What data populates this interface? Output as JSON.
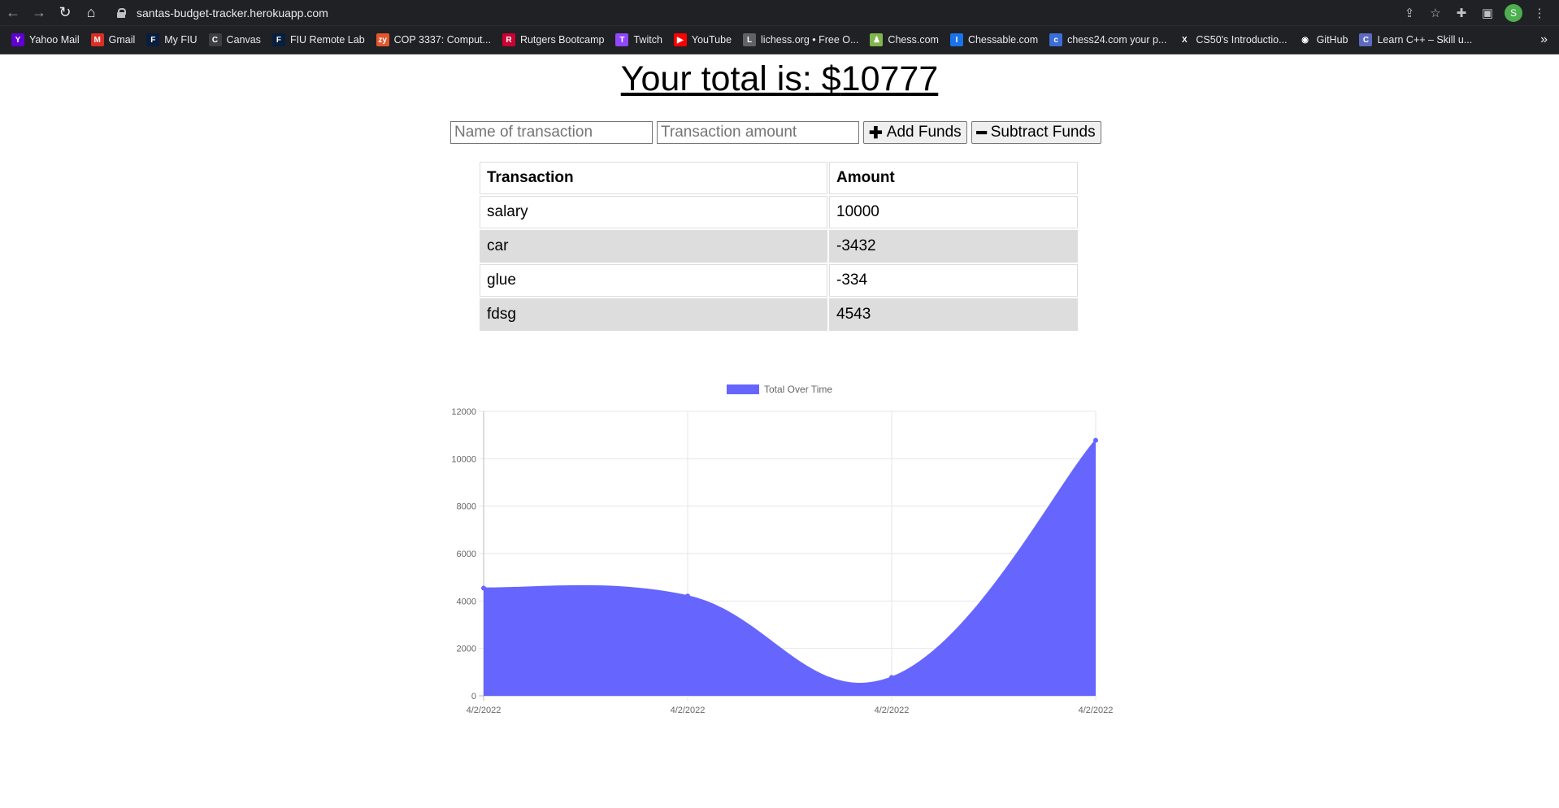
{
  "browser": {
    "url": "santas-budget-tracker.herokuapp.com",
    "avatar_letter": "S",
    "bookmarks": [
      {
        "label": "Yahoo Mail",
        "color": "#6001d2",
        "glyph": "Y"
      },
      {
        "label": "Gmail",
        "color": "#d93025",
        "glyph": "M"
      },
      {
        "label": "My FIU",
        "color": "#081e3f",
        "glyph": "F"
      },
      {
        "label": "Canvas",
        "color": "#3c4043",
        "glyph": "C"
      },
      {
        "label": "FIU Remote Lab",
        "color": "#081e3f",
        "glyph": "F"
      },
      {
        "label": "COP 3337: Comput...",
        "color": "#e4572e",
        "glyph": "zy"
      },
      {
        "label": "Rutgers Bootcamp",
        "color": "#cc0033",
        "glyph": "R"
      },
      {
        "label": "Twitch",
        "color": "#9146ff",
        "glyph": "T"
      },
      {
        "label": "YouTube",
        "color": "#ff0000",
        "glyph": "▶"
      },
      {
        "label": "lichess.org • Free O...",
        "color": "#5f6368",
        "glyph": "L"
      },
      {
        "label": "Chess.com",
        "color": "#81b64c",
        "glyph": "♟"
      },
      {
        "label": "Chessable.com",
        "color": "#1a73e8",
        "glyph": "I"
      },
      {
        "label": "chess24.com your p...",
        "color": "#3d6ed8",
        "glyph": "c"
      },
      {
        "label": "CS50's Introductio...",
        "color": "#202124",
        "glyph": "X"
      },
      {
        "label": "GitHub",
        "color": "#202124",
        "glyph": "◉"
      },
      {
        "label": "Learn C++ – Skill u...",
        "color": "#5c6bc0",
        "glyph": "C"
      }
    ]
  },
  "header": {
    "total_label": "Your total is: $",
    "total_value": "10777"
  },
  "form": {
    "name_placeholder": "Name of transaction",
    "amount_placeholder": "Transaction amount",
    "add_label": "Add Funds",
    "subtract_label": "Subtract Funds"
  },
  "table": {
    "headers": [
      "Transaction",
      "Amount"
    ],
    "rows": [
      {
        "name": "salary",
        "amount": "10000"
      },
      {
        "name": "car",
        "amount": "-3432"
      },
      {
        "name": "glue",
        "amount": "-334"
      },
      {
        "name": "fdsg",
        "amount": "4543"
      }
    ]
  },
  "chart_data": {
    "type": "area",
    "x": [
      "4/2/2022",
      "4/2/2022",
      "4/2/2022",
      "4/2/2022"
    ],
    "series": [
      {
        "name": "Total Over Time",
        "values": [
          4543,
          4209,
          777,
          10777
        ]
      }
    ],
    "ylim": [
      0,
      12000
    ],
    "yticks": [
      0,
      2000,
      4000,
      6000,
      8000,
      10000,
      12000
    ],
    "legend": "top",
    "grid": true,
    "fill_color": "#6666ff",
    "line_color": "#6666ff"
  }
}
